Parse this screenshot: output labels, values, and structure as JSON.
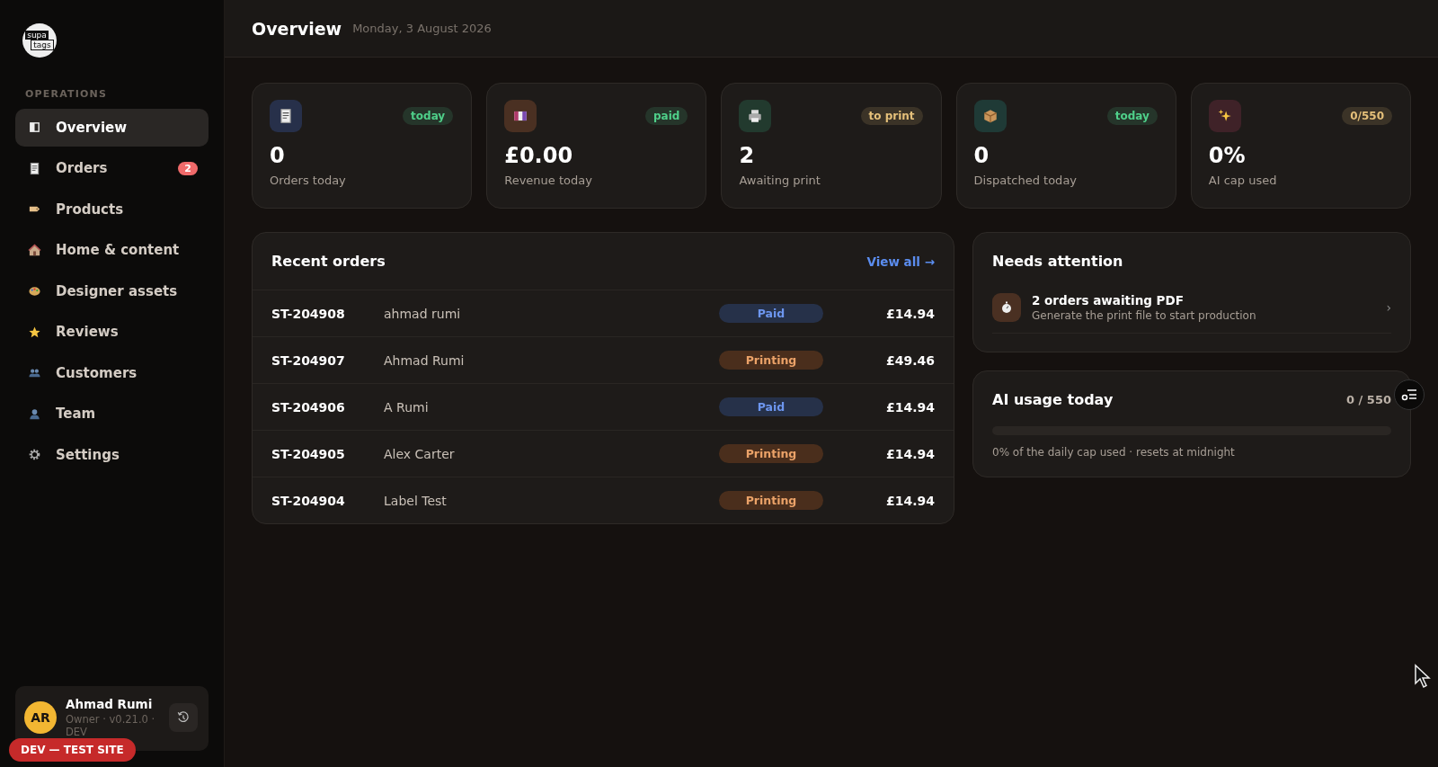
{
  "brand": {
    "logo_top": "supa",
    "logo_bottom": "tags"
  },
  "sidebar": {
    "section": "OPERATIONS",
    "items": [
      {
        "label": "Overview",
        "kind": "panel",
        "selected": true
      },
      {
        "label": "Orders",
        "kind": "receipt",
        "selected": false,
        "badge": "2"
      },
      {
        "label": "Products",
        "kind": "tag",
        "selected": false
      },
      {
        "label": "Home & content",
        "kind": "house",
        "selected": false
      },
      {
        "label": "Designer assets",
        "kind": "palette",
        "selected": false
      },
      {
        "label": "Reviews",
        "kind": "star",
        "selected": false
      },
      {
        "label": "Customers",
        "kind": "people",
        "selected": false
      },
      {
        "label": "Team",
        "kind": "person",
        "selected": false
      },
      {
        "label": "Settings",
        "kind": "gear",
        "selected": false
      }
    ]
  },
  "user": {
    "initials": "AR",
    "name": "Ahmad Rumi",
    "meta": "Owner · v0.21.0 · DEV",
    "env_badge": "DEV — TEST SITE"
  },
  "header": {
    "title": "Overview",
    "date": "Monday, 3 August 2026"
  },
  "stats": [
    {
      "kind": "receipt",
      "badge": "today",
      "color": "#4fd08a",
      "value": "0",
      "label": "Orders today"
    },
    {
      "kind": "money",
      "badge": "paid",
      "color": "#4fd08a",
      "value": "£0.00",
      "label": "Revenue today"
    },
    {
      "kind": "printer",
      "badge": "to print",
      "color": "#e5c07a",
      "value": "2",
      "label": "Awaiting print"
    },
    {
      "kind": "box",
      "badge": "today",
      "color": "#4fd08a",
      "value": "0",
      "label": "Dispatched today"
    },
    {
      "kind": "sparkle",
      "badge": "0/550",
      "color": "#e5c07a",
      "value": "0%",
      "label": "AI cap used"
    }
  ],
  "recent_orders": {
    "title": "Recent orders",
    "link": "View all →",
    "rows": [
      {
        "id": "ST-204908",
        "customer": "ahmad rumi",
        "status": "Paid",
        "kind": "paid",
        "total": "£14.94"
      },
      {
        "id": "ST-204907",
        "customer": "Ahmad Rumi",
        "status": "Printing",
        "kind": "printing",
        "total": "£49.46"
      },
      {
        "id": "ST-204906",
        "customer": "A Rumi",
        "status": "Paid",
        "kind": "paid",
        "total": "£14.94"
      },
      {
        "id": "ST-204905",
        "customer": "Alex Carter",
        "status": "Printing",
        "kind": "printing",
        "total": "£14.94"
      },
      {
        "id": "ST-204904",
        "customer": "Label Test",
        "status": "Printing",
        "kind": "printing",
        "total": "£14.94"
      }
    ]
  },
  "needs_attention": {
    "title": "Needs attention",
    "items": [
      {
        "title": "2 orders awaiting PDF",
        "subtitle": "Generate the print file to start production",
        "chevron": "›"
      }
    ]
  },
  "ai_usage": {
    "title": "AI usage today",
    "reading": "0 / 550",
    "level": 0.0,
    "note": "0% of the daily cap used · resets at midnight"
  }
}
